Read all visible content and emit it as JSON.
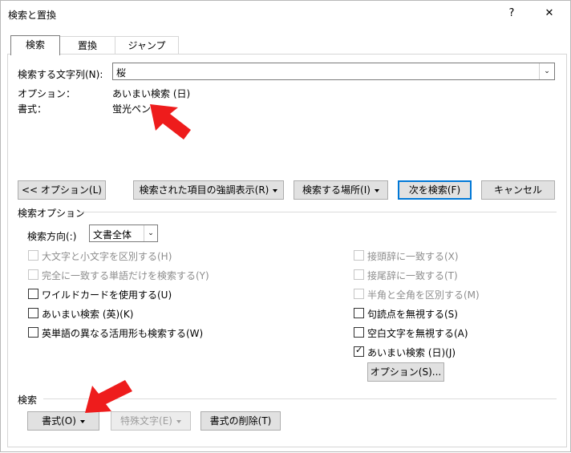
{
  "window": {
    "title": "検索と置換",
    "help": "?",
    "close": "✕"
  },
  "tabs": [
    {
      "label": "検索"
    },
    {
      "label": "置換"
    },
    {
      "label": "ジャンプ"
    }
  ],
  "find": {
    "label": "検索する文字列(N):",
    "value": "桜"
  },
  "summary": {
    "option_label": "オプション：",
    "option_value": "あいまい検索 (日)",
    "format_label": "書式：",
    "format_value": "蛍光ペン"
  },
  "buttons": {
    "less_options": "<< オプション(L)",
    "highlight": "検索された項目の強調表示(R)",
    "find_in": "検索する場所(I)",
    "find_next": "次を検索(F)",
    "cancel": "キャンセル",
    "options": "オプション(S)...",
    "format": "書式(O)",
    "special": "特殊文字(E)",
    "no_format": "書式の削除(T)"
  },
  "search_options": {
    "header": "検索オプション",
    "direction_label": "検索方向(:)",
    "direction_value": "文書全体",
    "left": [
      {
        "label": "大文字と小文字を区別する(H)",
        "checked": false,
        "enabled": false
      },
      {
        "label": "完全に一致する単語だけを検索する(Y)",
        "checked": false,
        "enabled": false
      },
      {
        "label": "ワイルドカードを使用する(U)",
        "checked": false,
        "enabled": true
      },
      {
        "label": "あいまい検索 (英)(K)",
        "checked": false,
        "enabled": true
      },
      {
        "label": "英単語の異なる活用形も検索する(W)",
        "checked": false,
        "enabled": true
      }
    ],
    "right": [
      {
        "label": "接頭辞に一致する(X)",
        "checked": false,
        "enabled": false
      },
      {
        "label": "接尾辞に一致する(T)",
        "checked": false,
        "enabled": false
      },
      {
        "label": "半角と全角を区別する(M)",
        "checked": false,
        "enabled": false
      },
      {
        "label": "句読点を無視する(S)",
        "checked": false,
        "enabled": true
      },
      {
        "label": "空白文字を無視する(A)",
        "checked": false,
        "enabled": true
      },
      {
        "label": "あいまい検索 (日)(J)",
        "checked": true,
        "enabled": true
      }
    ]
  },
  "bottom": {
    "header": "検索"
  },
  "colors": {
    "arrow": "#ee1c1c",
    "accent": "#0078d7"
  }
}
